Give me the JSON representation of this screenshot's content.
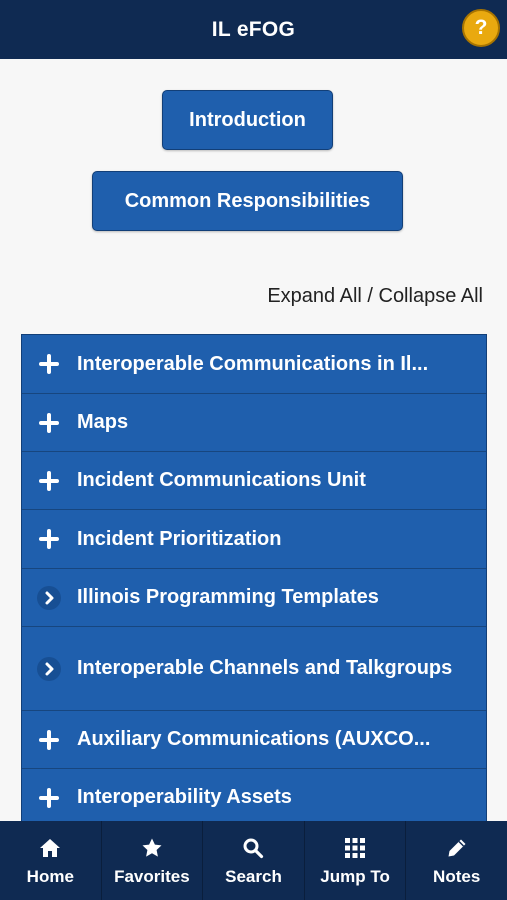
{
  "header": {
    "title": "IL eFOG",
    "help_label": "?"
  },
  "buttons": {
    "introduction": "Introduction",
    "common": "Common Responsibilities"
  },
  "expand_collapse": "Expand All / Collapse All",
  "sections": [
    {
      "label": "Interoperable Communications in Il...",
      "icon": "plus-icon"
    },
    {
      "label": "Maps",
      "icon": "plus-icon"
    },
    {
      "label": "Incident Communications Unit",
      "icon": "plus-icon"
    },
    {
      "label": "Incident Prioritization",
      "icon": "plus-icon"
    },
    {
      "label": "Illinois Programming Templates",
      "icon": "chevron-right-icon"
    },
    {
      "label": "Interoperable Channels and Talkgroups",
      "icon": "chevron-right-icon"
    },
    {
      "label": "Auxiliary Communications (AUXCO...",
      "icon": "plus-icon"
    },
    {
      "label": "Interoperability Assets",
      "icon": "plus-icon"
    }
  ],
  "tabs": [
    {
      "label": "Home",
      "icon": "home-icon"
    },
    {
      "label": "Favorites",
      "icon": "star-icon"
    },
    {
      "label": "Search",
      "icon": "search-icon"
    },
    {
      "label": "Jump To",
      "icon": "grid-icon"
    },
    {
      "label": "Notes",
      "icon": "pencil-icon"
    }
  ],
  "colors": {
    "header_bg": "#0f2a52",
    "button_blue": "#1f5fad",
    "help_gold": "#e9a90f",
    "page_bg": "#f7f7f7"
  }
}
